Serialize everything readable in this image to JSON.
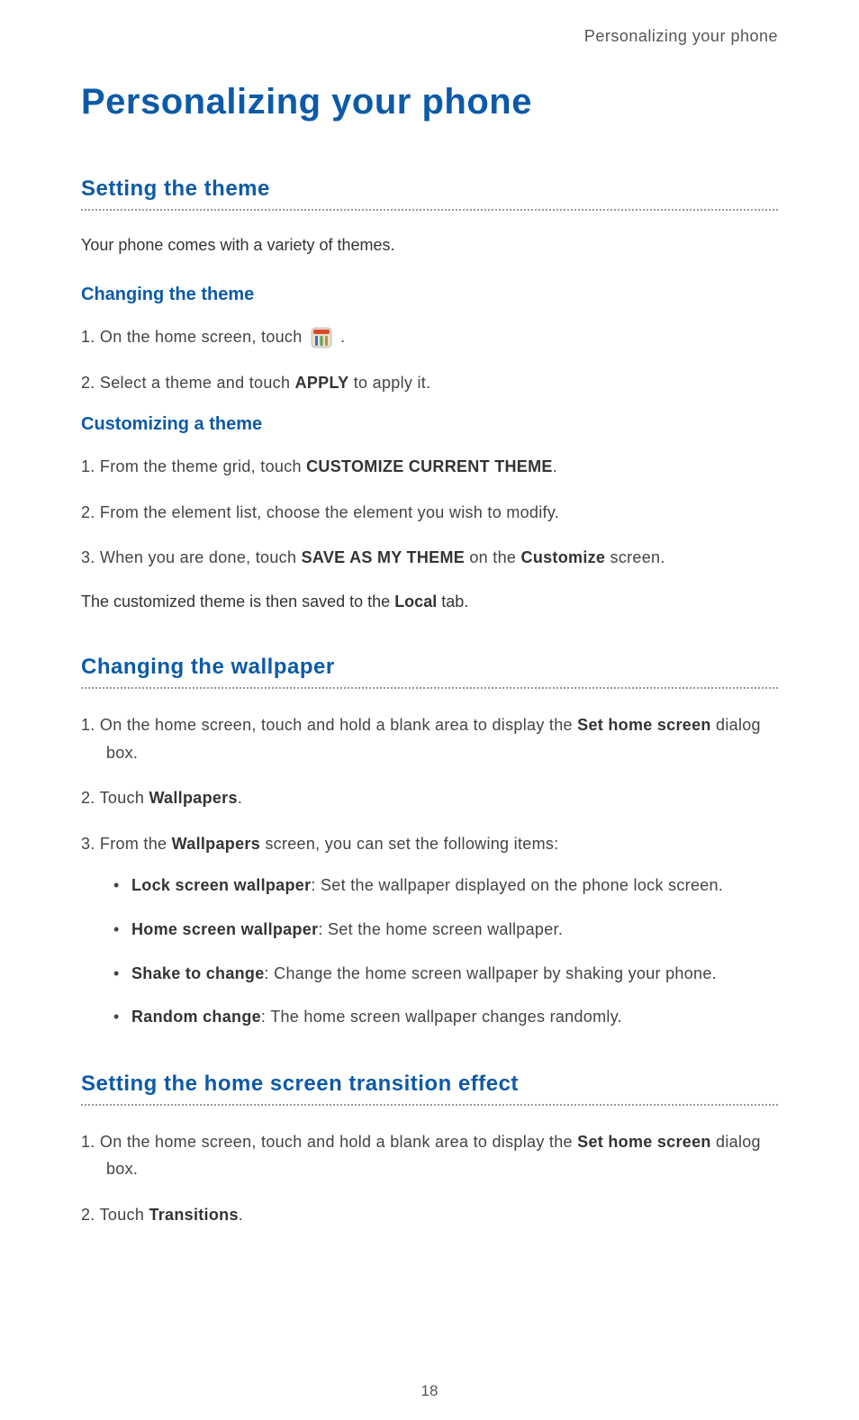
{
  "header": "Personalizing your phone",
  "mainTitle": "Personalizing your phone",
  "section1": {
    "title": "Setting the theme",
    "intro": "Your phone comes with a variety of themes.",
    "sub1": {
      "heading": "Changing  the  theme",
      "step1_pre": "On the home screen, touch ",
      "step1_post": " .",
      "step2_pre": "Select a theme and touch ",
      "step2_bold": "APPLY",
      "step2_post": " to apply it."
    },
    "sub2": {
      "heading": "Customizing  a  theme",
      "step1_pre": "From the theme grid, touch ",
      "step1_bold": "CUSTOMIZE CURRENT THEME",
      "step1_post": ".",
      "step2": "From the element list, choose the element you wish to modify.",
      "step3_pre": "When you are done, touch ",
      "step3_bold1": "SAVE AS MY THEME",
      "step3_mid": " on the ",
      "step3_bold2": "Customize",
      "step3_post": " screen.",
      "note_pre": "The customized theme is then saved to the ",
      "note_bold": "Local",
      "note_post": " tab."
    }
  },
  "section2": {
    "title": "Changing the wallpaper",
    "step1_pre": "On the home screen, touch and hold a blank area to display the ",
    "step1_bold": "Set home screen",
    "step1_post": " dialog box.",
    "step2_pre": "Touch ",
    "step2_bold": "Wallpapers",
    "step2_post": ".",
    "step3_pre": "From the ",
    "step3_bold": "Wallpapers",
    "step3_post": " screen, you can set the following items:",
    "bullets": {
      "b1_bold": "Lock screen wallpaper",
      "b1_text": ": Set the wallpaper displayed on the phone lock screen.",
      "b2_bold": "Home screen wallpaper",
      "b2_text": ": Set the home screen wallpaper.",
      "b3_bold": "Shake to change",
      "b3_text": ": Change the home screen wallpaper by shaking your phone.",
      "b4_bold": "Random change",
      "b4_text": ": The home screen wallpaper changes randomly."
    }
  },
  "section3": {
    "title": "Setting the home screen transition effect",
    "step1_pre": "On the home screen, touch and hold a blank area to display the ",
    "step1_bold": "Set home screen",
    "step1_post": " dialog box.",
    "step2_pre": "Touch ",
    "step2_bold": "Transitions",
    "step2_post": "."
  },
  "pageNumber": "18"
}
